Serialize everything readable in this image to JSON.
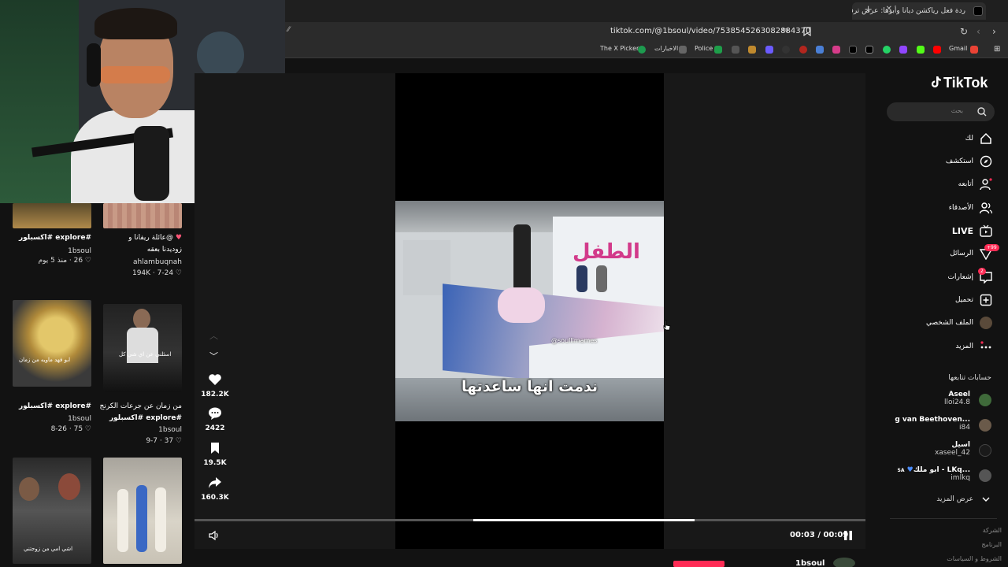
{
  "browser": {
    "tab_title": "ردة فعل رياكشن ديانا وأبوها: عرض ترفيه",
    "url": "tiktok.com/@1bsoul/video/7538545263082884370",
    "bookmarks": [
      "Gmail",
      "Police",
      "الاخبارات",
      "The X Picker"
    ]
  },
  "left_grid": [
    {
      "caption": "#explore #اكسبلور",
      "user": "1bsoul",
      "meta": "26 · منذ 5 يوم"
    },
    {
      "caption": "@عائلة ريفانا و",
      "caption2": "زوديدنا بعقه",
      "user": "ahlambuqnah",
      "meta": "194K · 7-24"
    },
    {
      "caption": "#explore #اكسبلور",
      "user": "1bsoul",
      "meta": "75 · 8-26"
    },
    {
      "caption": "من زمان عن جرعات الكرنج",
      "caption2": "#explore #اكسبلور",
      "user": "1bsoul",
      "meta": "37 · 9-7"
    },
    {
      "thumb_text": "ابو فهد ماويه من زمان"
    },
    {
      "thumb_text": "اسئلني عن اي شي كل"
    },
    {
      "thumb_text": "اشي امي من زوجتني"
    }
  ],
  "video": {
    "subtitle": "ندمت انها ساعدتها",
    "watermark": "@soulllmames",
    "banner_text": "الطفل",
    "time": "00:03 / 00:09",
    "progress": 0.33
  },
  "actions": {
    "likes": "182.2K",
    "comments": "2422",
    "saves": "19.5K",
    "shares": "160.3K"
  },
  "nav": {
    "logo": "TikTok",
    "search_placeholder": "بحث",
    "items": [
      "لك",
      "استكشف",
      "أتابعه",
      "الأصدقاء",
      "LIVE",
      "الرسائل",
      "إشعارات",
      "تحميل",
      "الملف الشخصي",
      "المزيد"
    ],
    "messages_badge": "99+",
    "notifications_badge": "2"
  },
  "following": {
    "title": "حسابات تتابعها",
    "accounts": [
      {
        "name": "Aseel",
        "handle": "lloi24.8"
      },
      {
        "name": "g van Beethoven...",
        "handle": "i84"
      },
      {
        "name": "اسيل",
        "handle": "xaseel_42"
      },
      {
        "name": "ابو ملك - LKq...",
        "handle": "imlkq",
        "flag": "SA"
      }
    ],
    "see_more": "عرض المزيد"
  },
  "footer": [
    "الشركة",
    "البرنامج",
    "الشروط و السياسات"
  ],
  "bottom_user": "1bsoul",
  "colors": {
    "accent": "#fe2c55",
    "bg": "#121212"
  }
}
